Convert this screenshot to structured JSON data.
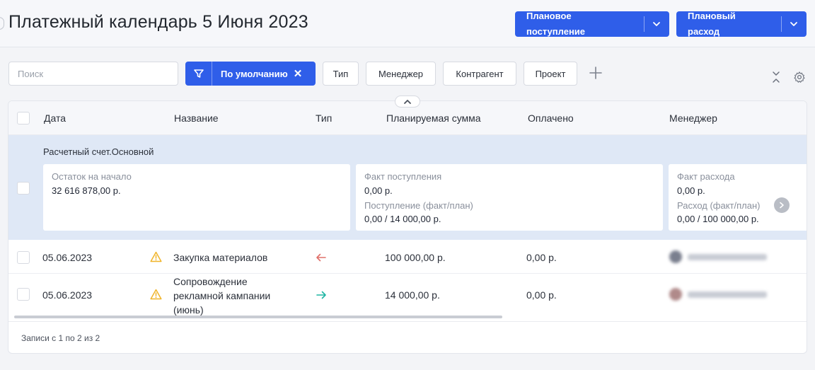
{
  "header": {
    "title": "Платежный календарь 5 Июня 2023",
    "btn_income": "Плановое поступление",
    "btn_expense": "Плановый расход"
  },
  "toolbar": {
    "search_placeholder": "Поиск",
    "active_filter": "По умолчанию",
    "chips": [
      "Тип",
      "Менеджер",
      "Контрагент",
      "Проект"
    ]
  },
  "table": {
    "columns": [
      "Дата",
      "Название",
      "Тип",
      "Планируемая сумма",
      "Оплачено",
      "Менеджер"
    ],
    "group": {
      "title": "Расчетный счет.Основной",
      "opening_label": "Остаток на начало",
      "opening_value": "32 616 878,00 р.",
      "income_fact_label": "Факт поступления",
      "income_fact_value": "0,00 р.",
      "income_ratio_label": "Поступление (факт/план)",
      "income_ratio_value": "0,00 / 14 000,00 р.",
      "expense_fact_label": "Факт расхода",
      "expense_fact_value": "0,00 р.",
      "expense_ratio_label": "Расход (факт/план)",
      "expense_ratio_value": "0,00 / 100 000,00 р."
    },
    "rows": [
      {
        "date": "05.06.2023",
        "name": "Закупка материалов",
        "type": "expense",
        "planned": "100 000,00 р.",
        "paid": "0,00 р."
      },
      {
        "date": "05.06.2023",
        "name_line1": "Сопровождение",
        "name_line2": "рекламной кампании",
        "name_line3": "(июнь)",
        "type": "income",
        "planned": "14 000,00 р.",
        "paid": "0,00 р."
      }
    ]
  },
  "footer": {
    "records": "Записи с 1 по 2 из 2"
  },
  "colors": {
    "accent": "#2f5ee9",
    "group_bg": "#dfe8f6",
    "warning": "#f0b429",
    "expense_arrow": "#e0706a",
    "income_arrow": "#1fb5a3"
  },
  "icons": [
    "filter-icon",
    "close-icon",
    "plus-icon",
    "collapse-icon",
    "gear-icon",
    "chevron-up-icon",
    "chevron-down-icon",
    "chevron-right-icon",
    "warning-icon",
    "arrow-left-icon",
    "arrow-right-icon"
  ]
}
